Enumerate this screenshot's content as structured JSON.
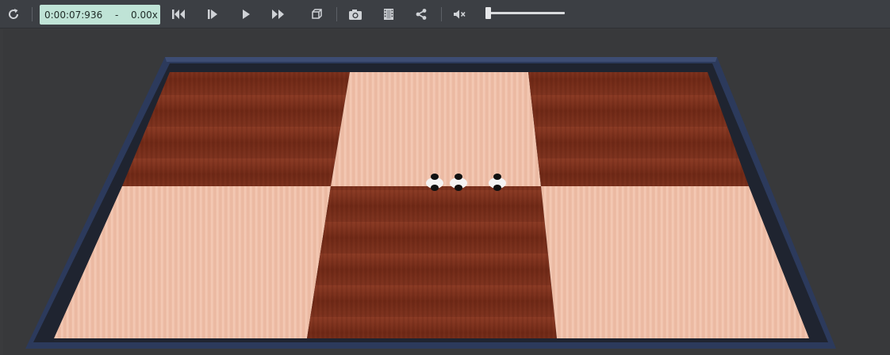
{
  "player": {
    "timestamp": "0:00:07:936",
    "separator": "-",
    "speed": "0.00x",
    "volume_level": 0.0
  },
  "toolbar": {
    "icons": [
      "refresh-icon",
      "skip-to-start-icon",
      "step-forward-icon",
      "play-icon",
      "fast-forward-icon",
      "3d-view-cube-icon",
      "camera-screenshot-icon",
      "film-record-icon",
      "share-icon",
      "mute-icon"
    ]
  },
  "scene": {
    "arena_border_color": "#2c3a5c",
    "dark_tile_color": "#7a2e1c",
    "light_tile_color": "#f0c0a8",
    "robot_count": 3
  }
}
